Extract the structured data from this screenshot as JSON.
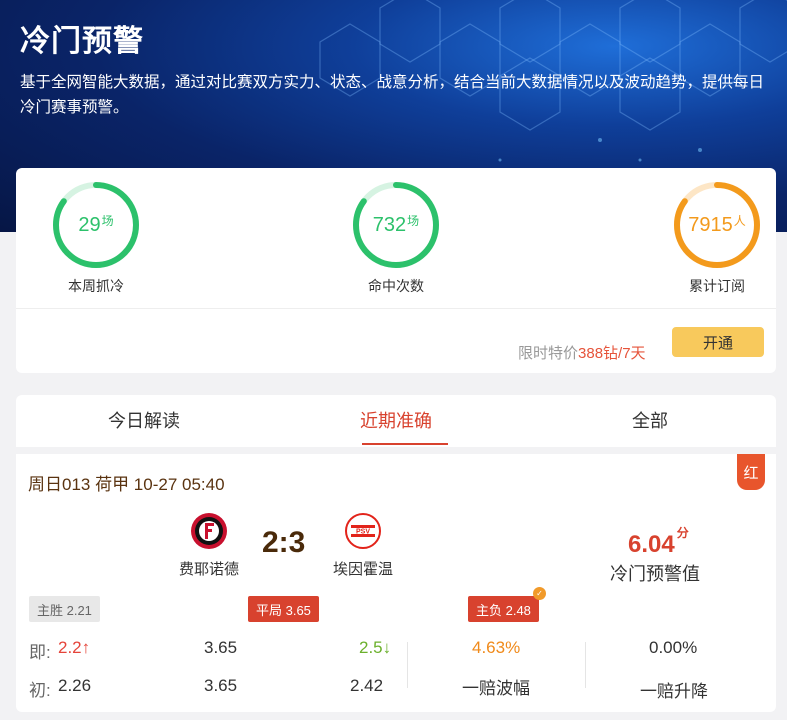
{
  "hero": {
    "title": "冷门预警",
    "description": "基于全网智能大数据，通过对比赛双方实力、状态、战意分析，结合当前大数据情况以及波动趋势，提供每日冷门赛事预警。"
  },
  "stats": [
    {
      "value": "29",
      "unit": "场",
      "label": "本周抓冷",
      "color": "#2cc16b",
      "track": "#d6f3e2",
      "progress": 0.85
    },
    {
      "value": "732",
      "unit": "场",
      "label": "命中次数",
      "color": "#2cc16b",
      "track": "#d6f3e2",
      "progress": 0.85
    },
    {
      "value": "7915",
      "unit": "人",
      "label": "累计订阅",
      "color": "#f39a1c",
      "track": "#fde6c6",
      "progress": 0.85
    }
  ],
  "promo": {
    "prefix": "限时特价",
    "price": "388钻/7天",
    "button": "开通"
  },
  "tabs": [
    {
      "label": "今日解读"
    },
    {
      "label": "近期准确"
    },
    {
      "label": "全部"
    }
  ],
  "match": {
    "header": "周日013 荷甲 10-27 05:40",
    "badge": "红",
    "home": {
      "name": "费耶诺德",
      "icon": "feyenoord-logo"
    },
    "away": {
      "name": "埃因霍温",
      "icon": "psv-logo"
    },
    "score": "2:3",
    "warning_value": "6.04",
    "warning_unit": "分",
    "warning_label": "冷门预警值",
    "tags": {
      "home_win": "主胜 2.21",
      "draw": "平局 3.65",
      "away_loss": "主负 2.48"
    },
    "now": {
      "label": "即:",
      "home": "2.2",
      "home_arrow": "↑",
      "draw": "3.65",
      "away": "2.5",
      "away_arrow": "↓"
    },
    "init": {
      "label": "初:",
      "home": "2.26",
      "draw": "3.65",
      "away": "2.42"
    },
    "fluct": {
      "value": "4.63%",
      "label": "一赔波幅"
    },
    "rise": {
      "value": "0.00%",
      "label": "一赔升降"
    },
    "colors": {
      "up": "#e5443a",
      "down": "#6bb02c",
      "fluct": "#f08a1a"
    }
  }
}
